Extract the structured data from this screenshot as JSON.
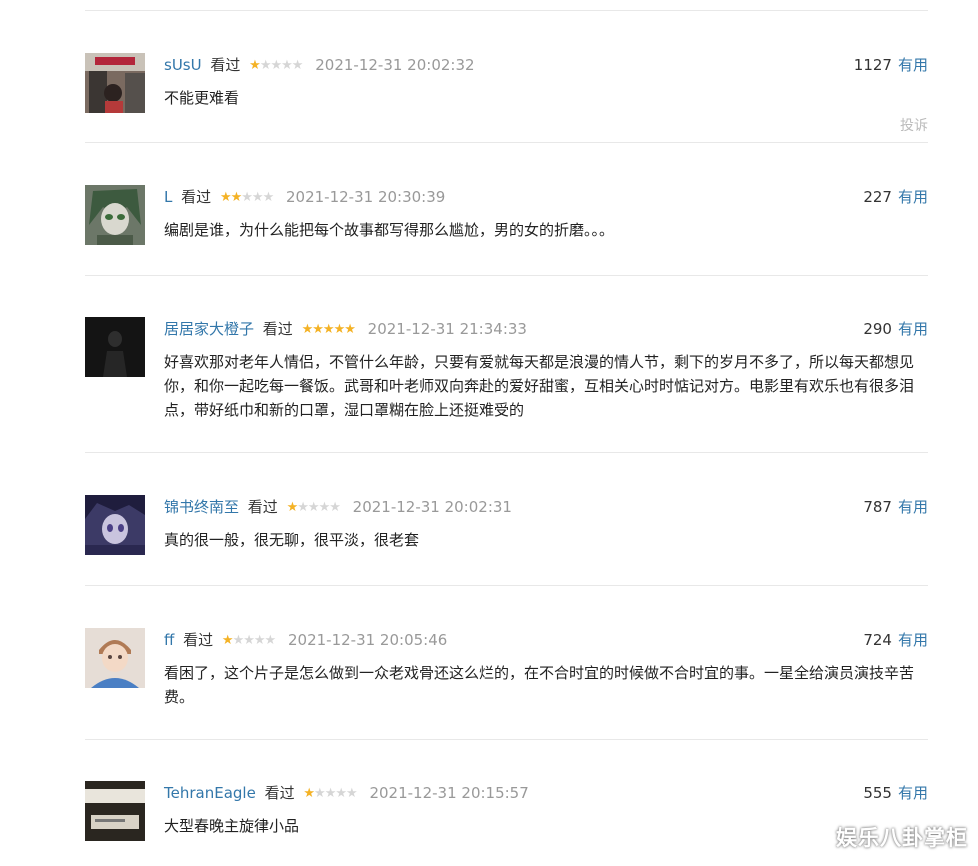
{
  "comments": [
    {
      "user": "sUsU",
      "watched_label": "看过",
      "rating": 1,
      "time": "2021-12-31 20:02:32",
      "votes": "1127",
      "useful_label": "有用",
      "text": "不能更难看",
      "report_label": "投诉"
    },
    {
      "user": "L",
      "watched_label": "看过",
      "rating": 2,
      "time": "2021-12-31 20:30:39",
      "votes": "227",
      "useful_label": "有用",
      "text": "编剧是谁，为什么能把每个故事都写得那么尴尬，男的女的折磨。。。"
    },
    {
      "user": "居居家大橙子",
      "watched_label": "看过",
      "rating": 5,
      "time": "2021-12-31 21:34:33",
      "votes": "290",
      "useful_label": "有用",
      "text": "好喜欢那对老年人情侣，不管什么年龄，只要有爱就每天都是浪漫的情人节，剩下的岁月不多了，所以每天都想见你，和你一起吃每一餐饭。武哥和叶老师双向奔赴的爱好甜蜜，互相关心时时惦记对方。电影里有欢乐也有很多泪点，带好纸巾和新的口罩，湿口罩糊在脸上还挺难受的"
    },
    {
      "user": "锦书终南至",
      "watched_label": "看过",
      "rating": 1,
      "time": "2021-12-31 20:02:31",
      "votes": "787",
      "useful_label": "有用",
      "text": "真的很一般，很无聊，很平淡，很老套"
    },
    {
      "user": "ff",
      "watched_label": "看过",
      "rating": 1,
      "time": "2021-12-31 20:05:46",
      "votes": "724",
      "useful_label": "有用",
      "text": "看困了，这个片子是怎么做到一众老戏骨还这么烂的，在不合时宜的时候做不合时宜的事。一星全给演员演技辛苦费。"
    },
    {
      "user": "TehranEagle",
      "watched_label": "看过",
      "rating": 1,
      "time": "2021-12-31 20:15:57",
      "votes": "555",
      "useful_label": "有用",
      "text": "大型春晚主旋律小品"
    }
  ],
  "colors": {
    "link": "#3377aa",
    "star_on": "#f4b225",
    "star_off": "#d6d6d6",
    "time": "#999999",
    "divider": "#e8e8e8"
  },
  "watermark": "娱乐八卦掌柜"
}
